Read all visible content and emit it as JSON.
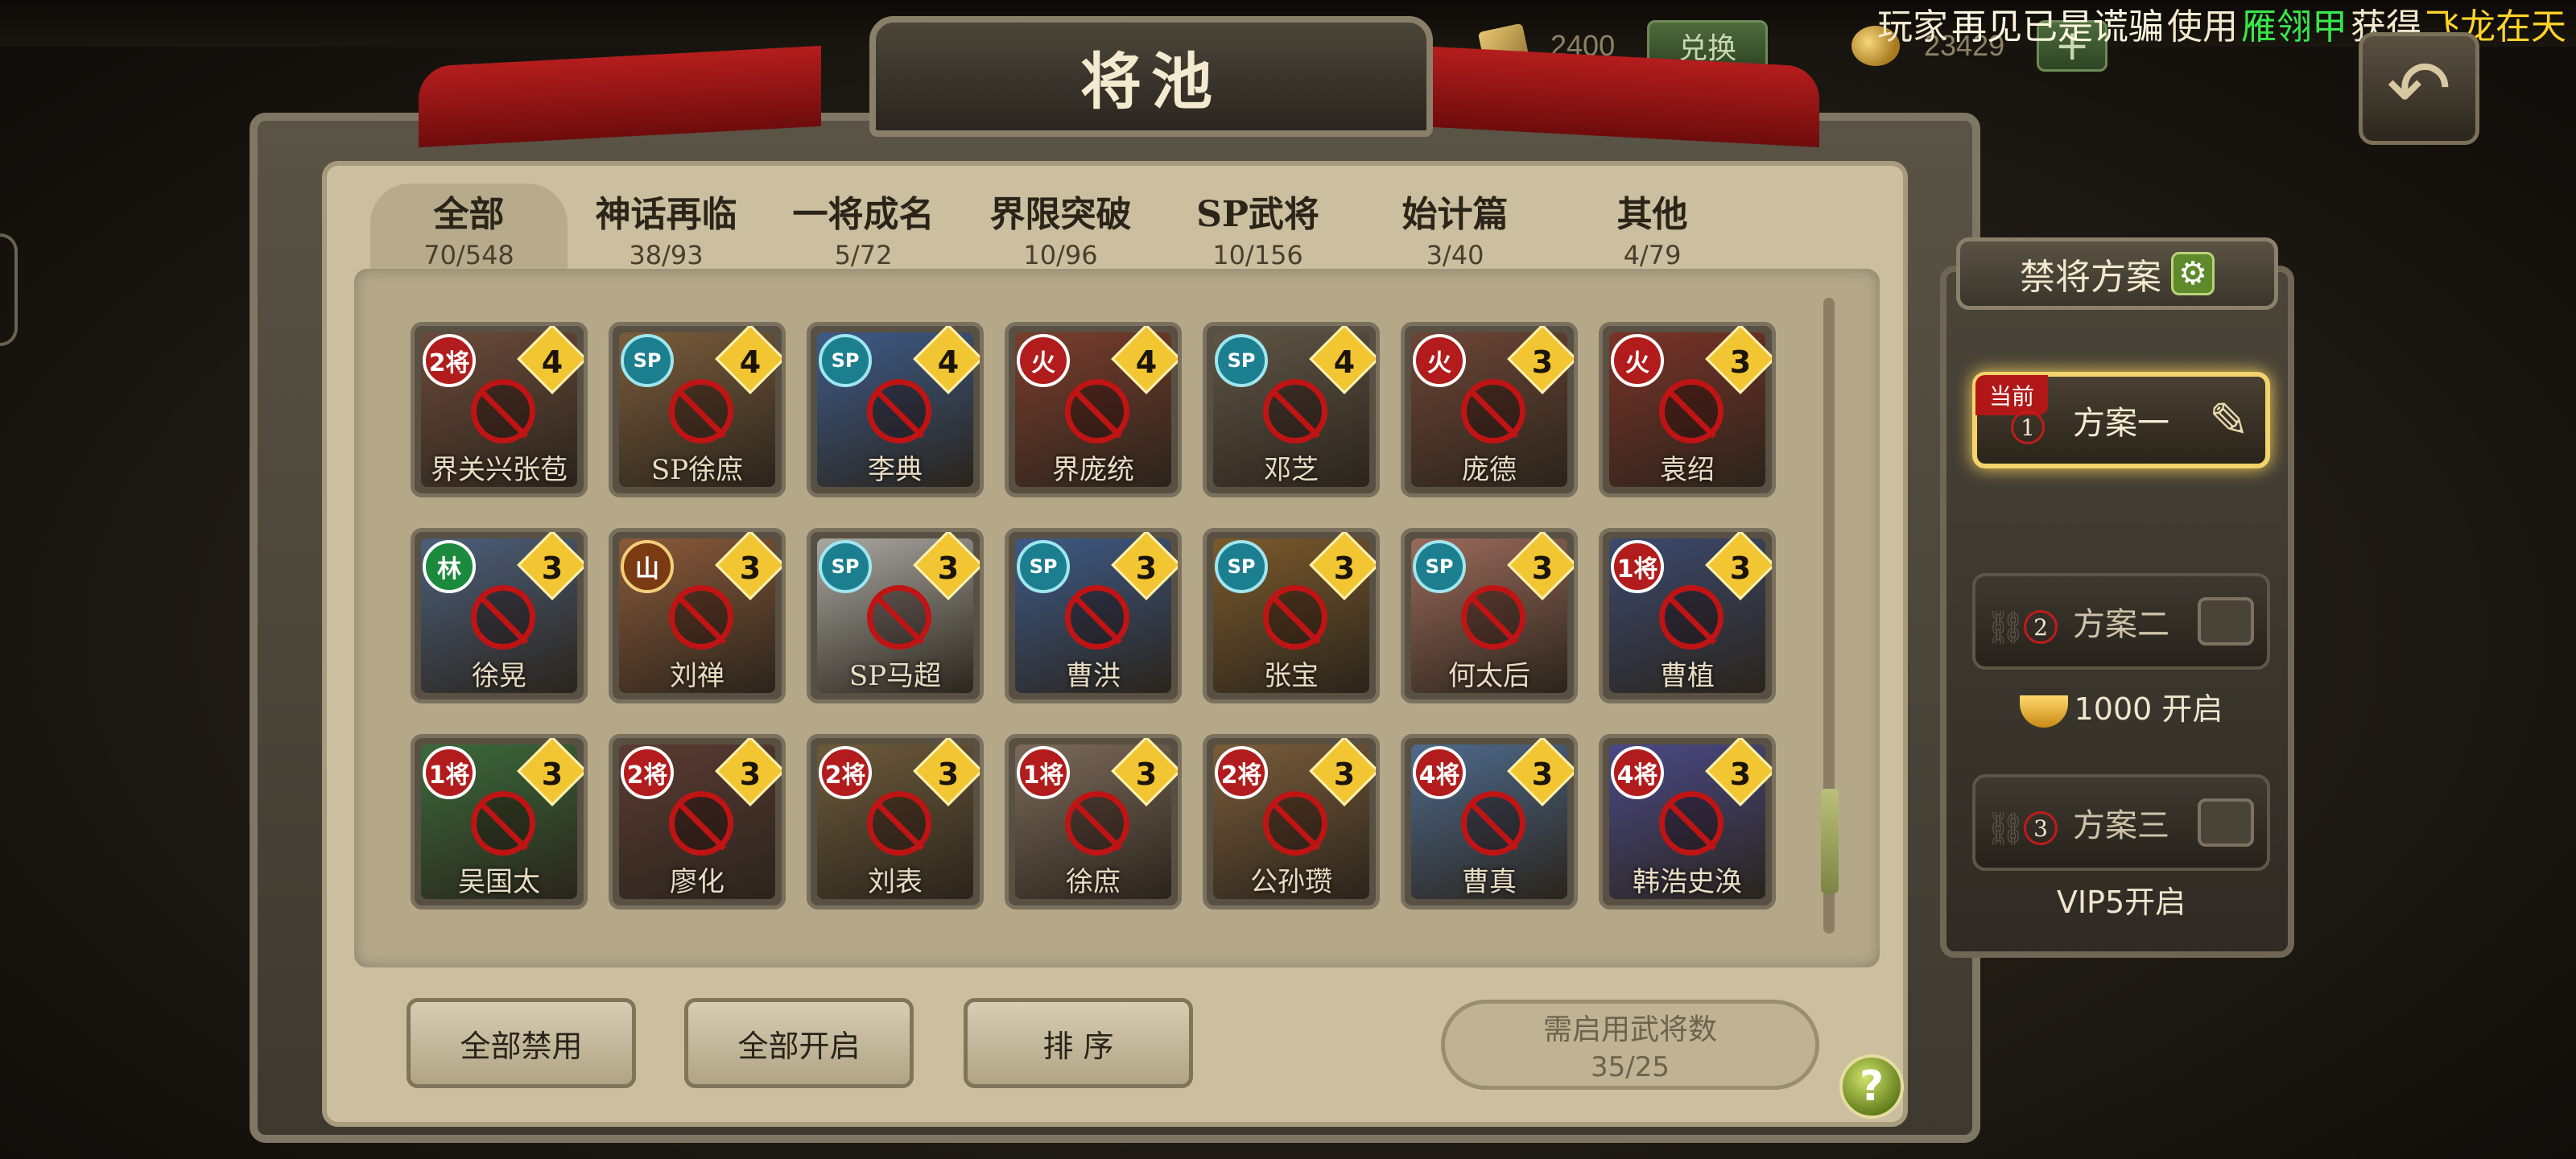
{
  "topbar": {
    "card_amount": "2400",
    "exchange_label": "兑换",
    "gold_amount": "23429",
    "plus_label": "+",
    "marquee": [
      {
        "text": "玩家",
        "color": "#f3e9cf"
      },
      {
        "text": "再见已是谎骗",
        "color": "#fff7e0"
      },
      {
        "text": "使用",
        "color": "#f3e9cf"
      },
      {
        "text": "雁翎甲",
        "color": "#38e84a"
      },
      {
        "text": "获得",
        "color": "#f3e9cf"
      },
      {
        "text": "飞龙在天",
        "color": "#ffd42a"
      }
    ]
  },
  "back_icon": "↶",
  "title": "将池",
  "tabs": [
    {
      "name": "全部",
      "count": "70/548"
    },
    {
      "name": "神话再临",
      "count": "38/93"
    },
    {
      "name": "一将成名",
      "count": "5/72"
    },
    {
      "name": "界限突破",
      "count": "10/96"
    },
    {
      "name": "SP武将",
      "count": "10/156"
    },
    {
      "name": "始计篇",
      "count": "3/40"
    },
    {
      "name": "其他",
      "count": "4/79"
    }
  ],
  "cards": [
    {
      "name": "界关兴张苞",
      "badge": "2将",
      "badge_type": "red",
      "cost": "4"
    },
    {
      "name": "SP徐庶",
      "badge": "SP",
      "badge_type": "sp",
      "cost": "4"
    },
    {
      "name": "李典",
      "badge": "SP",
      "badge_type": "sp",
      "cost": "4"
    },
    {
      "name": "界庞统",
      "badge": "火",
      "badge_type": "red",
      "cost": "4"
    },
    {
      "name": "邓芝",
      "badge": "SP",
      "badge_type": "sp",
      "cost": "4"
    },
    {
      "name": "庞德",
      "badge": "火",
      "badge_type": "red",
      "cost": "3"
    },
    {
      "name": "袁绍",
      "badge": "火",
      "badge_type": "red",
      "cost": "3"
    },
    {
      "name": "徐晃",
      "badge": "林",
      "badge_type": "green",
      "cost": "3"
    },
    {
      "name": "刘禅",
      "badge": "山",
      "badge_type": "mtn",
      "cost": "3"
    },
    {
      "name": "SP马超",
      "badge": "SP",
      "badge_type": "sp",
      "cost": "3"
    },
    {
      "name": "曹洪",
      "badge": "SP",
      "badge_type": "sp",
      "cost": "3"
    },
    {
      "name": "张宝",
      "badge": "SP",
      "badge_type": "sp",
      "cost": "3"
    },
    {
      "name": "何太后",
      "badge": "SP",
      "badge_type": "sp",
      "cost": "3"
    },
    {
      "name": "曹植",
      "badge": "1将",
      "badge_type": "red",
      "cost": "3"
    },
    {
      "name": "吴国太",
      "badge": "1将",
      "badge_type": "red",
      "cost": "3"
    },
    {
      "name": "廖化",
      "badge": "2将",
      "badge_type": "red",
      "cost": "3"
    },
    {
      "name": "刘表",
      "badge": "2将",
      "badge_type": "red",
      "cost": "3"
    },
    {
      "name": "徐庶",
      "badge": "1将",
      "badge_type": "red",
      "cost": "3"
    },
    {
      "name": "公孙瓒",
      "badge": "2将",
      "badge_type": "red",
      "cost": "3"
    },
    {
      "name": "曹真",
      "badge": "4将",
      "badge_type": "red",
      "cost": "3"
    },
    {
      "name": "韩浩史涣",
      "badge": "4将",
      "badge_type": "red",
      "cost": "3"
    }
  ],
  "buttons": {
    "ban_all": "全部禁用",
    "enable_all": "全部开启",
    "sort": "排 序"
  },
  "need": {
    "label": "需启用武将数",
    "value": "35/25"
  },
  "help_label": "?",
  "side": {
    "title": "禁将方案",
    "gear_icon": "⚙",
    "plan1": {
      "tag": "当前",
      "num": "1",
      "name": "方案一"
    },
    "plan2": {
      "num": "2",
      "name": "方案二",
      "unlock": "1000 开启"
    },
    "plan3": {
      "num": "3",
      "name": "方案三",
      "unlock": "VIP5开启"
    }
  }
}
